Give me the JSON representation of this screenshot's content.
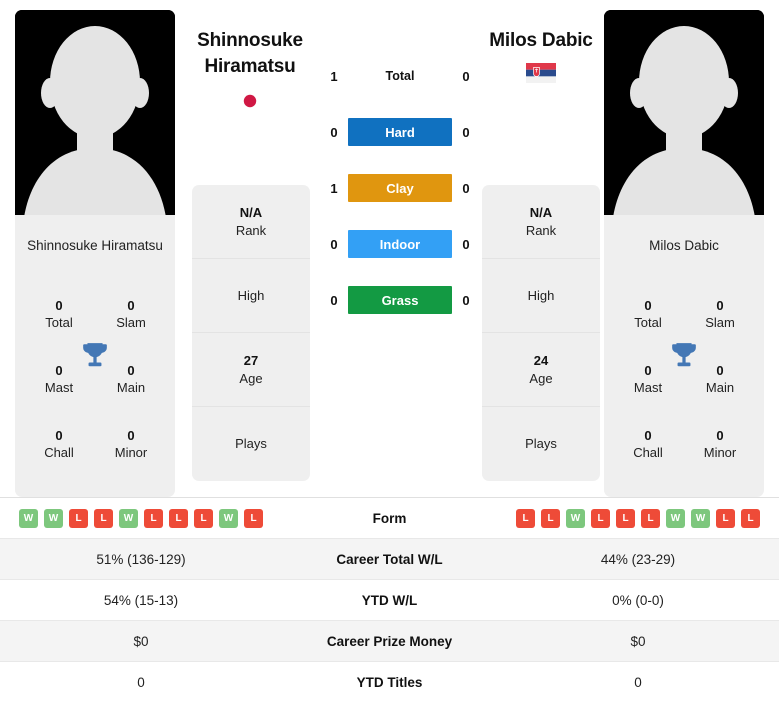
{
  "players": {
    "left": {
      "name": "Shinnosuke Hiramatsu",
      "name_line1": "Shinnosuke",
      "name_line2": "Hiramatsu",
      "card_name": "Shinnosuke Hiramatsu",
      "flag": "japan-flag",
      "rank": "N/A",
      "rank_label": "Rank",
      "high": "",
      "high_label": "High",
      "age": "27",
      "age_label": "Age",
      "plays": "",
      "plays_label": "Plays",
      "titles": [
        {
          "num": "0",
          "label": "Total"
        },
        {
          "num": "0",
          "label": "Slam"
        },
        {
          "num": "0",
          "label": "Mast"
        },
        {
          "num": "0",
          "label": "Main"
        },
        {
          "num": "0",
          "label": "Chall"
        },
        {
          "num": "0",
          "label": "Minor"
        }
      ],
      "form": [
        "W",
        "W",
        "L",
        "L",
        "W",
        "L",
        "L",
        "L",
        "W",
        "L"
      ],
      "career_wl": "51% (136-129)",
      "ytd_wl": "54% (15-13)",
      "prize_money": "$0",
      "ytd_titles": "0"
    },
    "right": {
      "name": "Milos Dabic",
      "name_line1": "Milos Dabic",
      "name_line2": "",
      "card_name": "Milos Dabic",
      "flag": "serbia-flag",
      "rank": "N/A",
      "rank_label": "Rank",
      "high": "",
      "high_label": "High",
      "age": "24",
      "age_label": "Age",
      "plays": "",
      "plays_label": "Plays",
      "titles": [
        {
          "num": "0",
          "label": "Total"
        },
        {
          "num": "0",
          "label": "Slam"
        },
        {
          "num": "0",
          "label": "Mast"
        },
        {
          "num": "0",
          "label": "Main"
        },
        {
          "num": "0",
          "label": "Chall"
        },
        {
          "num": "0",
          "label": "Minor"
        }
      ],
      "form": [
        "L",
        "L",
        "W",
        "L",
        "L",
        "L",
        "W",
        "W",
        "L",
        "L"
      ],
      "career_wl": "44% (23-29)",
      "ytd_wl": "0% (0-0)",
      "prize_money": "$0",
      "ytd_titles": "0"
    }
  },
  "surfaces": [
    {
      "label": "Total",
      "left": "1",
      "right": "0",
      "color": "transparent",
      "bar": false
    },
    {
      "label": "Hard",
      "left": "0",
      "right": "0",
      "color": "#1071c0",
      "bar": true
    },
    {
      "label": "Clay",
      "left": "1",
      "right": "0",
      "color": "#e0960f",
      "bar": true
    },
    {
      "label": "Indoor",
      "left": "0",
      "right": "0",
      "color": "#33a0f5",
      "bar": true
    },
    {
      "label": "Grass",
      "left": "0",
      "right": "0",
      "color": "#139a43",
      "bar": true
    }
  ],
  "comparison_rows": [
    {
      "label": "Form",
      "left": "",
      "right": "",
      "type": "form",
      "shaded": false
    },
    {
      "label": "Career Total W/L",
      "left": "51% (136-129)",
      "right": "44% (23-29)",
      "type": "text",
      "shaded": true
    },
    {
      "label": "YTD W/L",
      "left": "54% (15-13)",
      "right": "0% (0-0)",
      "type": "text",
      "shaded": false
    },
    {
      "label": "Career Prize Money",
      "left": "$0",
      "right": "$0",
      "type": "text",
      "shaded": true
    },
    {
      "label": "YTD Titles",
      "left": "0",
      "right": "0",
      "type": "text",
      "shaded": false
    }
  ],
  "colors": {
    "hard": "#1071c0",
    "clay": "#e0960f",
    "indoor": "#33a0f5",
    "grass": "#139a43",
    "win_badge": "#7dc77d",
    "loss_badge": "#ee4b38",
    "card_bg": "#efefef",
    "trophy": "#4377b5"
  }
}
